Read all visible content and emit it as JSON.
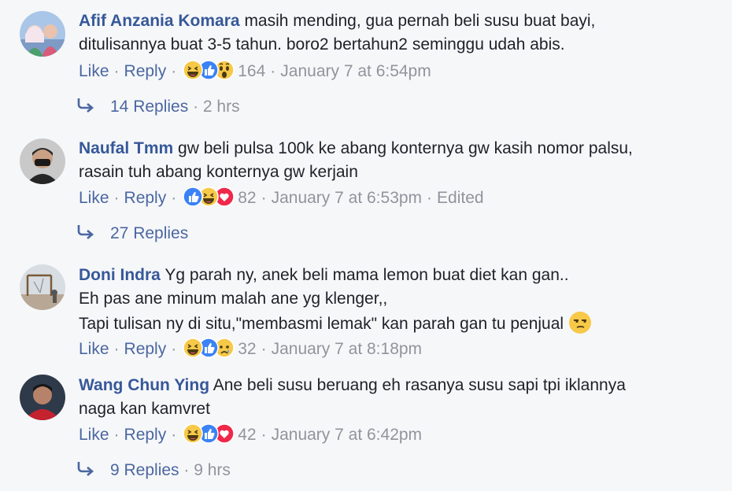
{
  "comments": [
    {
      "author": "Afif Anzania Komara",
      "line1": "masih mending, gua pernah beli susu buat bayi,",
      "line2": "ditulisannya buat 3-5 tahun. boro2 bertahun2 seminggu udah abis.",
      "like": "Like",
      "reply": "Reply",
      "reaction_icons": [
        "haha-icon",
        "like-icon",
        "wow-icon"
      ],
      "count": "164",
      "time": "January 7 at 6:54pm",
      "replies": "14 Replies",
      "replies_ago": "2 hrs"
    },
    {
      "author": "Naufal Tmm",
      "line1": "gw beli pulsa 100k ke abang konternya gw kasih nomor palsu,",
      "line2": "rasain tuh abang konternya gw kerjain",
      "like": "Like",
      "reply": "Reply",
      "reaction_icons": [
        "like-icon",
        "haha-icon",
        "love-icon"
      ],
      "count": "82",
      "time": "January 7 at 6:53pm",
      "edited": "Edited",
      "replies": "27 Replies"
    },
    {
      "author": "Doni Indra",
      "line1": "Yg parah ny, anek beli mama lemon buat diet kan gan..",
      "line2": "Eh pas ane minum malah ane yg klenger,,",
      "line3": "Tapi tulisan ny di situ,\"membasmi lemak\" kan parah gan tu penjual",
      "like": "Like",
      "reply": "Reply",
      "reaction_icons": [
        "haha-icon",
        "like-icon",
        "sad-icon"
      ],
      "count": "32",
      "time": "January 7 at 8:18pm"
    },
    {
      "author": "Wang Chun Ying",
      "line1": "Ane beli susu beruang eh rasanya susu sapi tpi iklannya",
      "line2": "naga kan kamvret",
      "like": "Like",
      "reply": "Reply",
      "reaction_icons": [
        "haha-icon",
        "like-icon",
        "love-icon"
      ],
      "count": "42",
      "time": "January 7 at 6:42pm",
      "replies": "9 Replies",
      "replies_ago": "9 hrs"
    }
  ],
  "colors": {
    "author": "#365899",
    "link": "#4b67a1",
    "meta": "#90949c",
    "like_blue": "#3b82f6",
    "love_red": "#f0284a",
    "emoji_yellow": "#f7c948"
  }
}
